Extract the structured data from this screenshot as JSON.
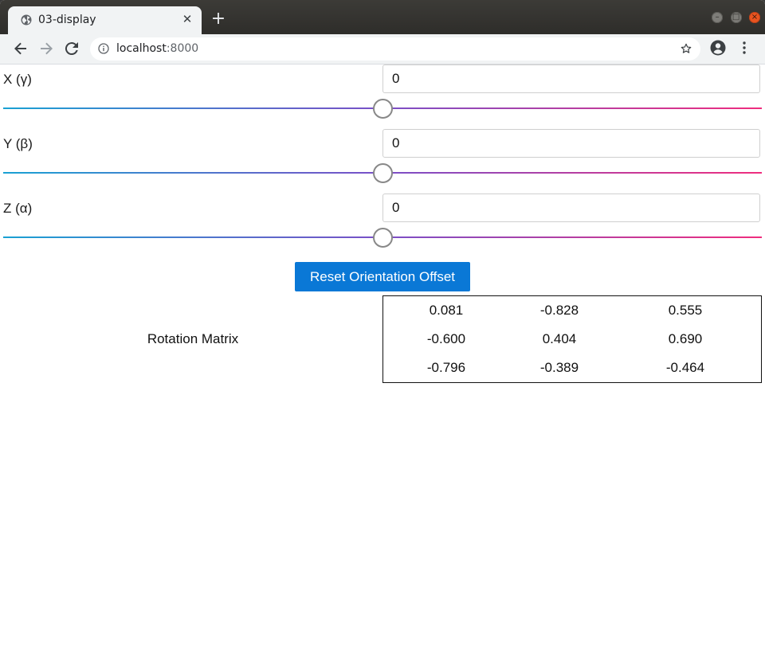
{
  "browser": {
    "tab_title": "03-display",
    "new_tab_symbol": "+",
    "close_symbol": "✕",
    "url_host": "localhost",
    "url_port": ":8000"
  },
  "controls": [
    {
      "label": "X (γ)",
      "value": "0",
      "slider_fraction": 0.5
    },
    {
      "label": "Y (β)",
      "value": "0",
      "slider_fraction": 0.5
    },
    {
      "label": "Z (α)",
      "value": "0",
      "slider_fraction": 0.5
    }
  ],
  "reset_button_label": "Reset Orientation Offset",
  "matrix": {
    "label": "Rotation Matrix",
    "rows": [
      [
        "0.081",
        "-0.828",
        "0.555"
      ],
      [
        "-0.600",
        "0.404",
        "0.690"
      ],
      [
        "-0.796",
        "-0.389",
        "-0.464"
      ]
    ]
  },
  "colors": {
    "button": "#0a78d6",
    "slider_start": "#1aa1d3",
    "slider_mid": "#7a4fc7",
    "slider_end": "#ef2d7e",
    "window_close": "#e95420"
  }
}
